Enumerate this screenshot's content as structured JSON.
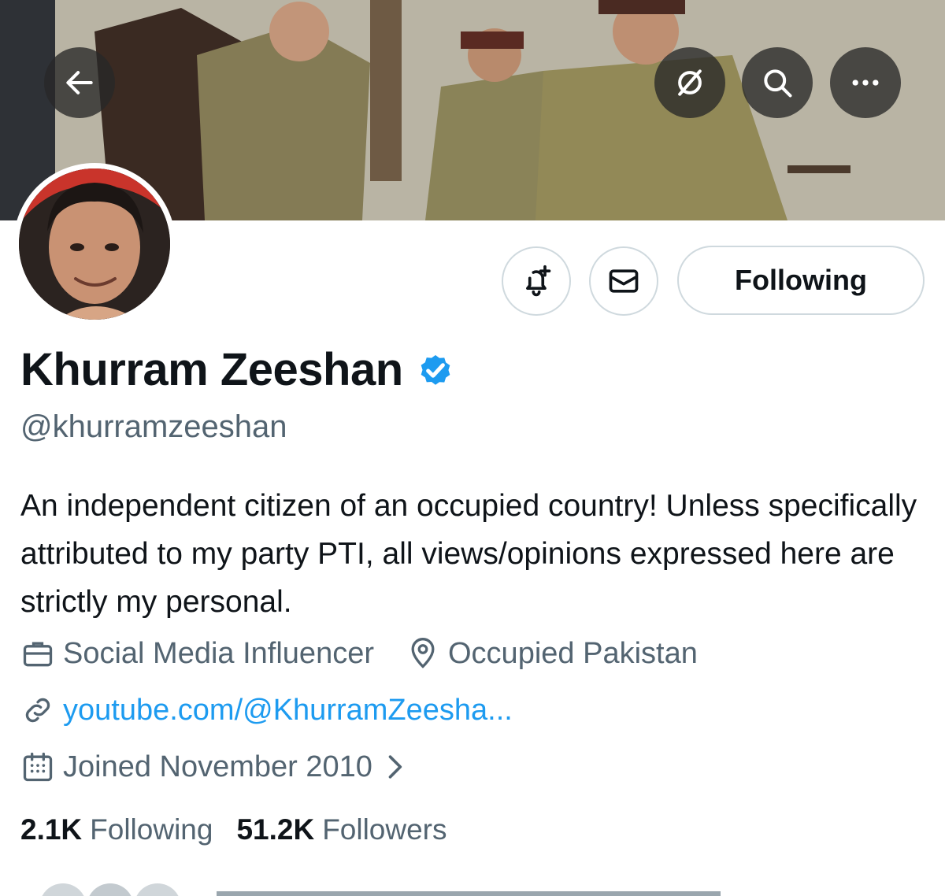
{
  "header": {
    "back_icon": "arrow-left-icon",
    "hide_icon": "eye-off-icon",
    "search_icon": "search-icon",
    "more_icon": "more-horizontal-icon"
  },
  "actions": {
    "notify_icon": "bell-plus-icon",
    "message_icon": "envelope-icon",
    "following_label": "Following"
  },
  "profile": {
    "name": "Khurram Zeeshan",
    "verified": true,
    "handle": "@khurramzeeshan",
    "bio": "An independent citizen of an occupied country! Unless specifically attributed to my party PTI, all views/opinions expressed here are strictly my personal.",
    "category": "Social Media Influencer",
    "location": "Occupied Pakistan",
    "website": "youtube.com/@KhurramZeesha...",
    "joined": "Joined November 2010"
  },
  "stats": {
    "following_count": "2.1K",
    "following_label": "Following",
    "followers_count": "51.2K",
    "followers_label": "Followers"
  },
  "colors": {
    "accent": "#1d9bf0",
    "text": "#0f1419",
    "muted": "#536471",
    "border": "#cfd9de"
  }
}
